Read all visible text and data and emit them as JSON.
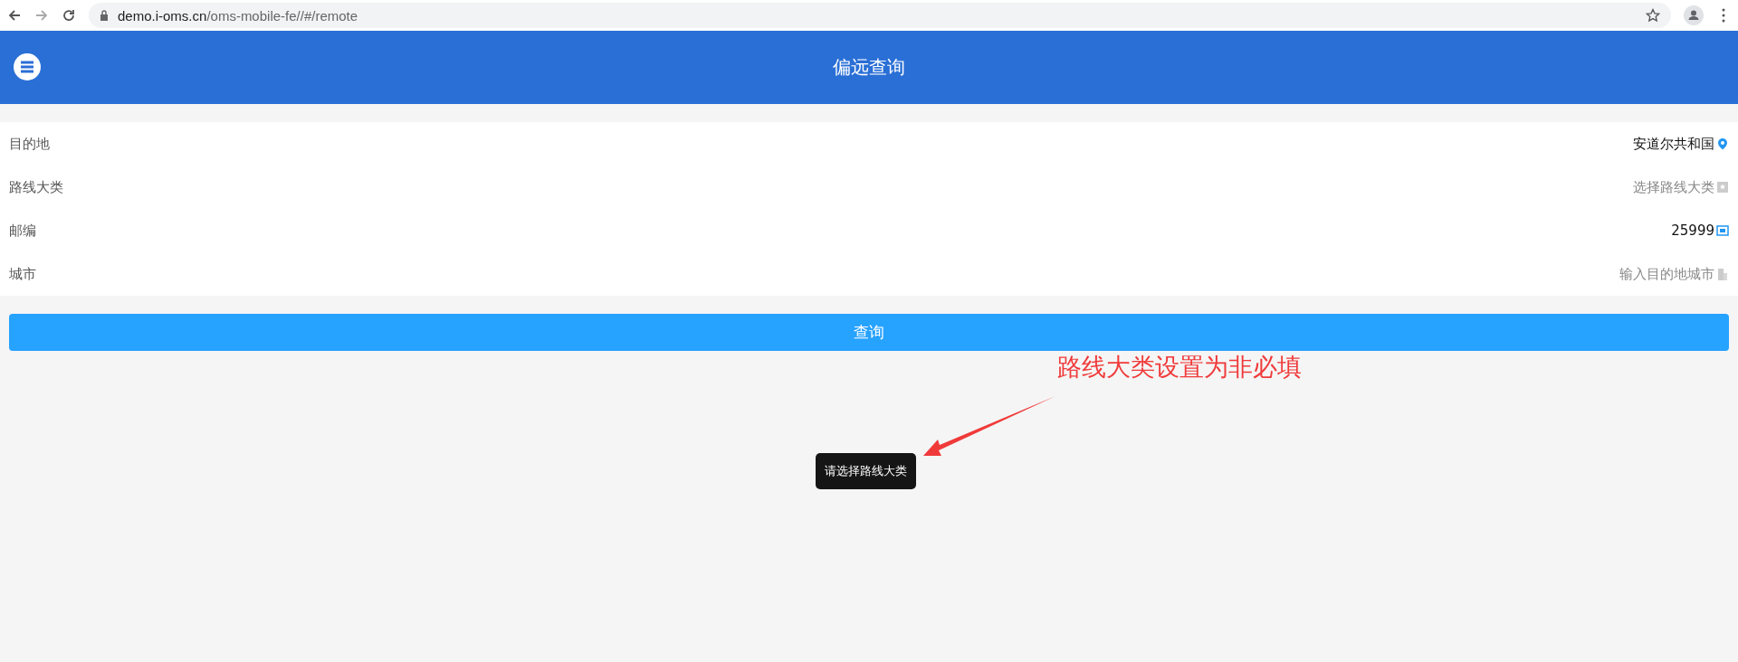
{
  "browser": {
    "url_host": "demo.i-oms.cn",
    "url_path": "/oms-mobile-fe//#/remote"
  },
  "header": {
    "title": "偏远查询"
  },
  "form": {
    "rows": [
      {
        "label": "目的地",
        "kind": "location",
        "value": "安道尔共和国"
      },
      {
        "label": "路线大类",
        "kind": "route",
        "placeholder": "选择路线大类"
      },
      {
        "label": "邮编",
        "kind": "postcode",
        "value": "25999"
      },
      {
        "label": "城市",
        "kind": "city",
        "placeholder": "输入目的地城市"
      }
    ]
  },
  "query_button": "查询",
  "toast": "请选择路线大类",
  "annotation": "路线大类设置为非必填"
}
